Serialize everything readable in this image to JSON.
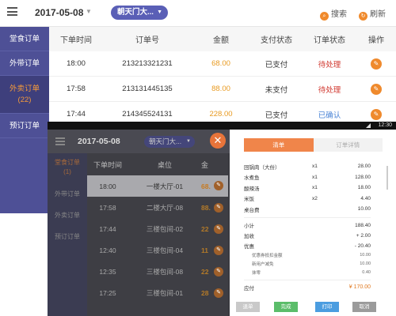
{
  "main": {
    "date": "2017-05-08",
    "store": "朝天门大...",
    "search_label": "搜索",
    "refresh_label": "刷新",
    "sidebar": [
      {
        "label": "堂食订单"
      },
      {
        "label": "外带订单"
      },
      {
        "label": "外卖订单",
        "count": "(22)"
      },
      {
        "label": "预订订单"
      }
    ],
    "columns": [
      "下单时间",
      "订单号",
      "金额",
      "支付状态",
      "订单状态",
      "操作"
    ],
    "rows": [
      {
        "time": "18:00",
        "order_no": "213213321231",
        "amount": "68.00",
        "pay": "已支付",
        "status": "待处理",
        "status_type": "pending"
      },
      {
        "time": "17:58",
        "order_no": "213131445135",
        "amount": "88.00",
        "pay": "未支付",
        "status": "待处理",
        "status_type": "pending"
      },
      {
        "time": "17:44",
        "order_no": "214345524131",
        "amount": "228.00",
        "pay": "已支付",
        "status": "已确认",
        "status_type": "confirmed"
      }
    ]
  },
  "overlay": {
    "status_time": "12:30",
    "date": "2017-05-08",
    "store": "朝天门大...",
    "sidebar": [
      {
        "label": "堂食订单",
        "count": "(1)"
      },
      {
        "label": "外带订单"
      },
      {
        "label": "外卖订单"
      },
      {
        "label": "预订订单"
      }
    ],
    "columns": [
      "下单时间",
      "桌位",
      "金"
    ],
    "rows": [
      {
        "time": "18:00",
        "desk": "一楼大厅-01",
        "amount": "68."
      },
      {
        "time": "17:58",
        "desk": "二楼大厅-08",
        "amount": "88."
      },
      {
        "time": "17:44",
        "desk": "三楼包间-02",
        "amount": "22"
      },
      {
        "time": "12:40",
        "desk": "三楼包间-04",
        "amount": "11"
      },
      {
        "time": "12:35",
        "desk": "三楼包间-08",
        "amount": "22"
      },
      {
        "time": "17:25",
        "desk": "三楼包间-01",
        "amount": "28"
      }
    ],
    "panel": {
      "tab_active": "清单",
      "tab_inactive": "订单详情",
      "items": [
        {
          "name": "回锅肉（大份）",
          "qty": "x1",
          "price": "28.00"
        },
        {
          "name": "水煮鱼",
          "qty": "x1",
          "price": "128.00"
        },
        {
          "name": "酸辣汤",
          "qty": "x1",
          "price": "18.00"
        },
        {
          "name": "米饭",
          "qty": "x2",
          "price": "4.40"
        },
        {
          "name": "桌台费",
          "qty": "",
          "price": "10.00"
        }
      ],
      "subtotal_label": "小计",
      "subtotal": "188.40",
      "surcharge_label": "加收",
      "surcharge": "+ 2.00",
      "discount_label": "优惠",
      "discount": "- 20.40",
      "discounts": [
        {
          "label": "优惠券抵扣金额",
          "value": "10.00"
        },
        {
          "label": "新用户减免",
          "value": "10.00"
        },
        {
          "label": "抹零",
          "value": "0.40"
        }
      ],
      "total_label": "应付",
      "total": "¥ 170.00",
      "buttons": {
        "btn1": "退单",
        "btn2": "完成",
        "btn3": "打印",
        "btn4": "取消"
      }
    }
  }
}
